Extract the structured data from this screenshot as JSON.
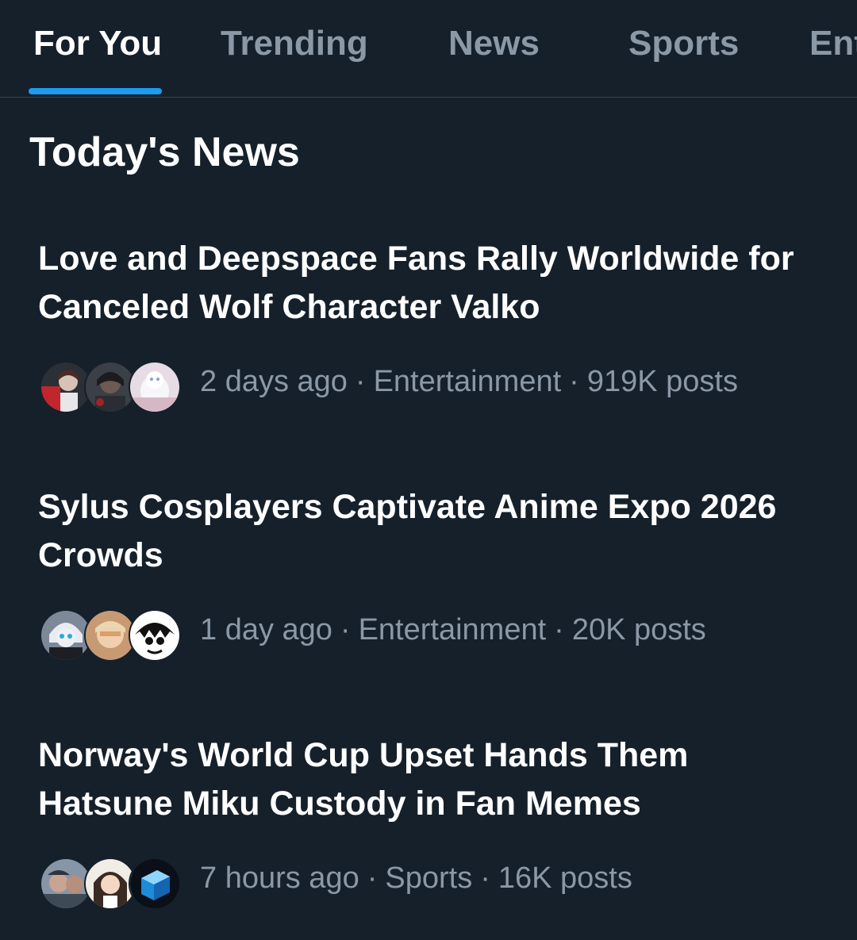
{
  "tabs": [
    {
      "label": "For You",
      "active": true
    },
    {
      "label": "Trending",
      "active": false
    },
    {
      "label": "News",
      "active": false
    },
    {
      "label": "Sports",
      "active": false
    },
    {
      "label": "Ent",
      "active": false
    }
  ],
  "section": {
    "title": "Today's News"
  },
  "stories": [
    {
      "title": "Love and Deepspace Fans Rally Worldwide for Canceled Wolf Character Valko",
      "time": "2 days ago",
      "category": "Entertainment",
      "posts": "919K posts",
      "avatar_colors": [
        "#7a2a2a",
        "#3a3e47",
        "#d8dbe6"
      ]
    },
    {
      "title": "Sylus Cosplayers Captivate Anime Expo 2026 Crowds",
      "time": "1 day ago",
      "category": "Entertainment",
      "posts": "20K posts",
      "avatar_colors": [
        "#8a95a8",
        "#d9a87a",
        "#e9e9e9"
      ]
    },
    {
      "title": "Norway's World Cup Upset Hands Them Hatsune Miku Custody in Fan Memes",
      "time": "7 hours ago",
      "category": "Sports",
      "posts": "16K posts",
      "avatar_colors": [
        "#7a8a9a",
        "#c9b39a",
        "#1f8ad8"
      ]
    }
  ],
  "colors": {
    "background": "#15202b",
    "accent": "#1d9bf0",
    "muted_text": "#8b98a5",
    "divider": "#38444d"
  }
}
